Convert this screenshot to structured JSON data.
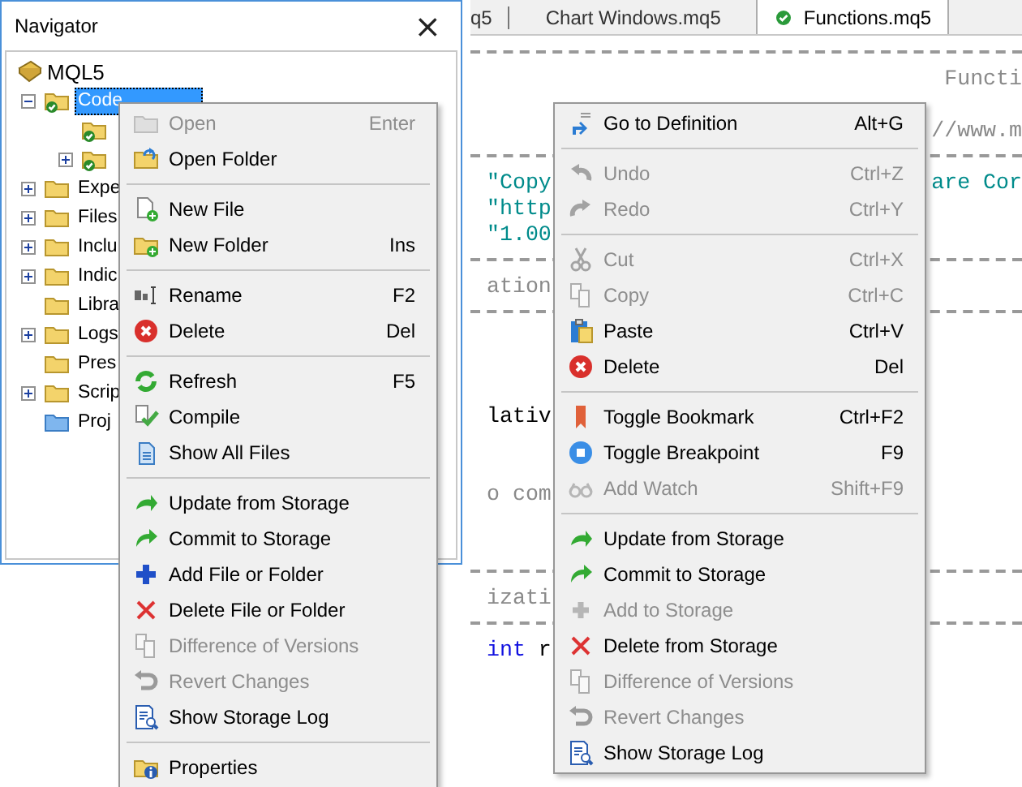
{
  "navigator": {
    "title": "Navigator",
    "close": "×",
    "root": {
      "label": "MQL5"
    },
    "items": [
      {
        "label": "Code",
        "kind": "storage",
        "selected": true,
        "expanded": true,
        "children": [
          {
            "kind": "storage"
          },
          {
            "kind": "storage",
            "expanded": false
          }
        ]
      },
      {
        "label": "Expe",
        "kind": "folder",
        "selected": false,
        "expanded": false
      },
      {
        "label": "Files",
        "kind": "folder",
        "selected": false,
        "expanded": false
      },
      {
        "label": "Inclu",
        "kind": "folder",
        "selected": false,
        "expanded": false
      },
      {
        "label": "Indic",
        "kind": "folder",
        "selected": false,
        "expanded": false
      },
      {
        "label": "Libra",
        "kind": "folder",
        "selected": false
      },
      {
        "label": "Logs",
        "kind": "folder",
        "selected": false,
        "expanded": false
      },
      {
        "label": "Pres",
        "kind": "folder",
        "selected": false
      },
      {
        "label": "Scrip",
        "kind": "folder",
        "selected": false,
        "expanded": false
      },
      {
        "label": "Proj",
        "kind": "project",
        "selected": false
      }
    ]
  },
  "editor": {
    "tabs": [
      {
        "label": "q5",
        "selected": false,
        "compiled": false
      },
      {
        "label": "Chart Windows.mq5",
        "selected": false,
        "compiled": false
      },
      {
        "label": "Functions.mq5",
        "selected": true,
        "compiled": true
      }
    ],
    "lines": [
      {
        "kind": "rule"
      },
      {
        "kind": "code",
        "right": [
          {
            "text": "Functi",
            "kind": "comment"
          }
        ]
      },
      {
        "kind": "blank"
      },
      {
        "kind": "code",
        "right": [
          {
            "text": "//www.m",
            "kind": "comment"
          }
        ]
      },
      {
        "kind": "rule"
      },
      {
        "kind": "code",
        "left": [
          {
            "text": "\"Copy",
            "kind": "string"
          }
        ],
        "right": [
          {
            "text": "are Cor",
            "kind": "string"
          }
        ]
      },
      {
        "kind": "code",
        "left": [
          {
            "text": "\"http",
            "kind": "string"
          }
        ]
      },
      {
        "kind": "code",
        "left": [
          {
            "text": "\"1.00",
            "kind": "string"
          }
        ]
      },
      {
        "kind": "rule"
      },
      {
        "kind": "code",
        "left": [
          {
            "text": "ation",
            "kind": "comment"
          }
        ]
      },
      {
        "kind": "rule"
      },
      {
        "kind": "blank"
      },
      {
        "kind": "blank"
      },
      {
        "kind": "blank"
      },
      {
        "kind": "code",
        "left": [
          {
            "text": "lativ",
            "kind": "plain"
          }
        ]
      },
      {
        "kind": "blank"
      },
      {
        "kind": "blank"
      },
      {
        "kind": "code",
        "left": [
          {
            "text": "o com",
            "kind": "comment"
          }
        ]
      },
      {
        "kind": "blank"
      },
      {
        "kind": "blank"
      },
      {
        "kind": "rule"
      },
      {
        "kind": "code",
        "left": [
          {
            "text": "izati",
            "kind": "comment"
          }
        ]
      },
      {
        "kind": "rule"
      },
      {
        "kind": "code",
        "left": [
          {
            "text": "int",
            "kind": "keyword"
          },
          {
            "text": " r",
            "kind": "plain"
          }
        ]
      }
    ]
  },
  "context_menus": [
    {
      "items": [
        {
          "kind": "item",
          "label": "Open",
          "shortcut": "Enter",
          "disabled": true
        },
        {
          "kind": "item",
          "label": "Open Folder",
          "disabled": false
        },
        {
          "kind": "separator"
        },
        {
          "kind": "item",
          "label": "New File",
          "disabled": false
        },
        {
          "kind": "item",
          "label": "New Folder",
          "shortcut": "Ins",
          "disabled": false
        },
        {
          "kind": "separator"
        },
        {
          "kind": "item",
          "label": "Rename",
          "shortcut": "F2",
          "disabled": false
        },
        {
          "kind": "item",
          "label": "Delete",
          "shortcut": "Del",
          "disabled": false
        },
        {
          "kind": "separator"
        },
        {
          "kind": "item",
          "label": "Refresh",
          "shortcut": "F5",
          "disabled": false
        },
        {
          "kind": "item",
          "label": "Compile",
          "disabled": false
        },
        {
          "kind": "item",
          "label": "Show All Files",
          "disabled": false
        },
        {
          "kind": "separator"
        },
        {
          "kind": "item",
          "label": "Update from Storage",
          "disabled": false
        },
        {
          "kind": "item",
          "label": "Commit to Storage",
          "disabled": false
        },
        {
          "kind": "item",
          "label": "Add File or Folder",
          "disabled": false
        },
        {
          "kind": "item",
          "label": "Delete File or Folder",
          "disabled": false
        },
        {
          "kind": "item",
          "label": "Difference of Versions",
          "disabled": true
        },
        {
          "kind": "item",
          "label": "Revert Changes",
          "disabled": true
        },
        {
          "kind": "item",
          "label": "Show Storage Log",
          "disabled": false
        },
        {
          "kind": "separator"
        },
        {
          "kind": "item",
          "label": "Properties",
          "disabled": false
        }
      ]
    },
    {
      "items": [
        {
          "kind": "item",
          "label": "Go to Definition",
          "shortcut": "Alt+G",
          "disabled": false
        },
        {
          "kind": "separator"
        },
        {
          "kind": "item",
          "label": "Undo",
          "shortcut": "Ctrl+Z",
          "disabled": true
        },
        {
          "kind": "item",
          "label": "Redo",
          "shortcut": "Ctrl+Y",
          "disabled": true
        },
        {
          "kind": "separator"
        },
        {
          "kind": "item",
          "label": "Cut",
          "shortcut": "Ctrl+X",
          "disabled": true
        },
        {
          "kind": "item",
          "label": "Copy",
          "shortcut": "Ctrl+C",
          "disabled": true
        },
        {
          "kind": "item",
          "label": "Paste",
          "shortcut": "Ctrl+V",
          "disabled": false
        },
        {
          "kind": "item",
          "label": "Delete",
          "shortcut": "Del",
          "disabled": false
        },
        {
          "kind": "separator"
        },
        {
          "kind": "item",
          "label": "Toggle Bookmark",
          "shortcut": "Ctrl+F2",
          "disabled": false
        },
        {
          "kind": "item",
          "label": "Toggle Breakpoint",
          "shortcut": "F9",
          "disabled": false
        },
        {
          "kind": "item",
          "label": "Add Watch",
          "shortcut": "Shift+F9",
          "disabled": true
        },
        {
          "kind": "separator"
        },
        {
          "kind": "item",
          "label": "Update from Storage",
          "disabled": false
        },
        {
          "kind": "item",
          "label": "Commit to Storage",
          "disabled": false
        },
        {
          "kind": "item",
          "label": "Add to Storage",
          "disabled": true
        },
        {
          "kind": "item",
          "label": "Delete from Storage",
          "disabled": false
        },
        {
          "kind": "item",
          "label": "Difference of Versions",
          "disabled": true
        },
        {
          "kind": "item",
          "label": "Revert Changes",
          "disabled": true
        },
        {
          "kind": "item",
          "label": "Show Storage Log",
          "disabled": false
        }
      ]
    }
  ]
}
